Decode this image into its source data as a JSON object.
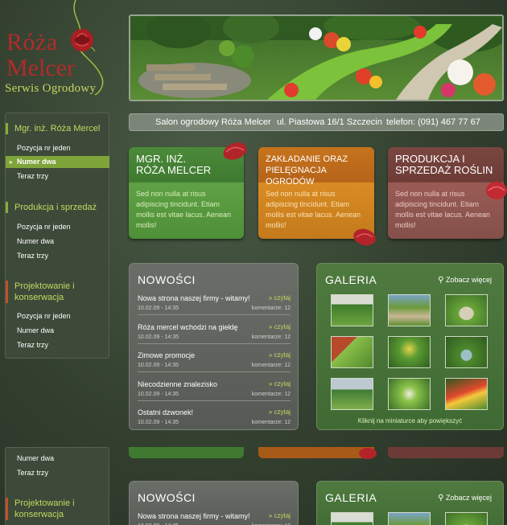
{
  "logo": {
    "line1": "Róża",
    "line2": "Melcer",
    "line3": "Serwis Ogrodowy"
  },
  "infobar": {
    "name": "Salon ogrodowy Róża Melcer",
    "address": "ul. Piastowa 16/1 Szczecin",
    "phone": "telefon: (091) 467 77 67"
  },
  "sidebar": {
    "head1": "Mgr. inż. Róża Mercel",
    "items1": [
      "Pozycja nr jeden",
      "Numer dwa",
      "Teraz trzy"
    ],
    "head2": "Produkcja i sprzedaż",
    "items2": [
      "Pozycja nr jeden",
      "Numer dwa",
      "Teraz trzy"
    ],
    "head3_l1": "Projektowanie i",
    "head3_l2": "konserwacja",
    "items3": [
      "Pozycja nr jeden",
      "Numer dwa",
      "Teraz trzy"
    ]
  },
  "sidebar2": {
    "items": [
      "Numer dwa",
      "Teraz trzy"
    ],
    "head_l1": "Projektowanie i",
    "head_l2": "konserwacja"
  },
  "cards": [
    {
      "l1": "MGR. INŻ.",
      "l2": "RÓŻA MELCER",
      "body": "Sed non nulla at risus adipiscing tincidunt. Etiam mollis est vitae lacus. Aenean mollis!"
    },
    {
      "l1": "ZAKŁADANIE ORAZ",
      "l2": "PIELĘGNACJA OGRODÓW",
      "body": "Sed non nulla at risus adipiscing tincidunt. Etiam mollis est vitae lacus. Aenean mollis!"
    },
    {
      "l1": "PRODUKCJA I",
      "l2": "SPRZEDAŻ ROŚLIN",
      "body": "Sed non nulla at risus adipiscing tincidunt. Etiam mollis est vitae lacus. Aenean mollis!"
    }
  ],
  "news": {
    "title": "NOWOŚCI",
    "read": "» czytaj",
    "items": [
      {
        "title": "Nowa strona naszej firmy - witamy!",
        "date": "10.02.09 - 14:35",
        "comments": "komentarze: 12"
      },
      {
        "title": "Róża mercel wchodzi na giełdę",
        "date": "10.02.09 - 14:35",
        "comments": "komentarze: 12"
      },
      {
        "title": "Zimowe promocje",
        "date": "10.02.09 - 14:35",
        "comments": "komentarze: 12"
      },
      {
        "title": "Niecodzienne znalezisko",
        "date": "10.02.09 - 14:35",
        "comments": "komentarze: 12"
      },
      {
        "title": "Ostatni dzwonek!",
        "date": "10.02.09 - 14:35",
        "comments": "komentarze: 12"
      }
    ]
  },
  "gallery": {
    "title": "GALERIA",
    "more": "Zobacz więcej",
    "note": "Kliknij na miniaturce aby powiększyć"
  },
  "colors": {
    "green": "#4e8f38",
    "orange": "#c47a1c",
    "brown": "#84504a",
    "accent": "#c3d860",
    "logo_red": "#b52a2a"
  }
}
